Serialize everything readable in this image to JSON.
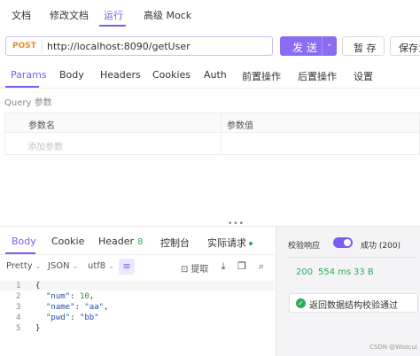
{
  "top_tabs": [
    "文档",
    "修改文档",
    "运行",
    "高级 Mock"
  ],
  "url_bar": {
    "method": "POST",
    "url": "http://localhost:8090/getUser",
    "send_label": "发 送",
    "save_label": "暂 存",
    "save_as_label": "保存为"
  },
  "request_tabs": [
    "Params",
    "Body",
    "Headers",
    "Cookies",
    "Auth",
    "前置操作",
    "后置操作",
    "设置"
  ],
  "query": {
    "section_label": "Query 参数",
    "col_name": "参数名",
    "col_value": "参数值",
    "add_placeholder": "添加参数"
  },
  "response_tabs": {
    "body": "Body",
    "cookie": "Cookie",
    "header": "Header",
    "header_count": "8",
    "console": "控制台",
    "actual_request": "实际请求"
  },
  "toolbar": {
    "format": "Pretty",
    "type": "JSON",
    "encoding": "utf8",
    "extract": "提取"
  },
  "code": {
    "line_numbers": [
      "1",
      "2",
      "3",
      "4",
      "5"
    ],
    "open_brace": "{",
    "close_brace": "}",
    "num_key": "\"num\"",
    "num_val": "10",
    "name_key": "\"name\"",
    "name_val": "\"aa\"",
    "pwd_key": "\"pwd\"",
    "pwd_val": "\"bb\""
  },
  "validation": {
    "label": "校验响应",
    "toggle_on": true,
    "status_text": "成功 (200)",
    "status_code": "200",
    "time": "554 ms",
    "size": "33 B",
    "result": "返回数据结构校验通过"
  },
  "watermark": "CSDN @Wozcui",
  "colors": {
    "accent": "#7a5cf0",
    "method": "#e98b2a",
    "success": "#2eaa5a"
  }
}
